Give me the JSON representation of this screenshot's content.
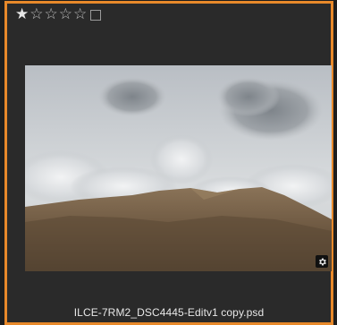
{
  "photo": {
    "rating": 1,
    "max_rating": 5,
    "filename": "ILCE-7RM2_DSC4445-Editv1 copy.psd",
    "selected_border_color": "#e8892a"
  },
  "icons": {
    "star_filled": "★",
    "star_empty": "☆",
    "settings": "gear-icon"
  }
}
